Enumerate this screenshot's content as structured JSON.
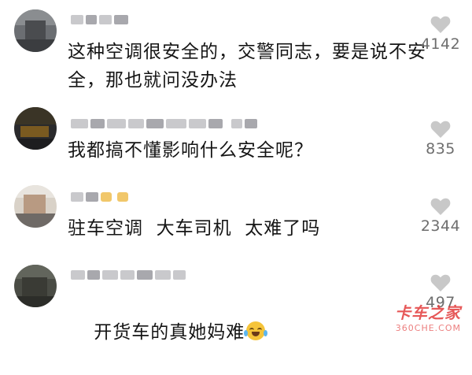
{
  "comments": [
    {
      "text": "这种空调很安全的，交警同志，要是说不安全，那也就问没办法",
      "likes": "4142",
      "avatar": "blurred"
    },
    {
      "text": "我都搞不懂影响什么安全呢？",
      "likes": "835",
      "avatar": "blurred"
    },
    {
      "text": "驻车空调  大车司机  太难了吗",
      "likes": "2344",
      "avatar": "blurred"
    },
    {
      "text": "开货车的真她妈难",
      "likes": "497",
      "avatar": "blurred",
      "emoji": "laughing-crying-emoji"
    }
  ],
  "icons": {
    "like": "heart-icon"
  },
  "colors": {
    "heart": "#c8c8c8",
    "count": "#6e6e6e",
    "watermark": "#e23b3b"
  },
  "watermark": {
    "main": "卡车之家",
    "sub": "360CHE.COM"
  }
}
